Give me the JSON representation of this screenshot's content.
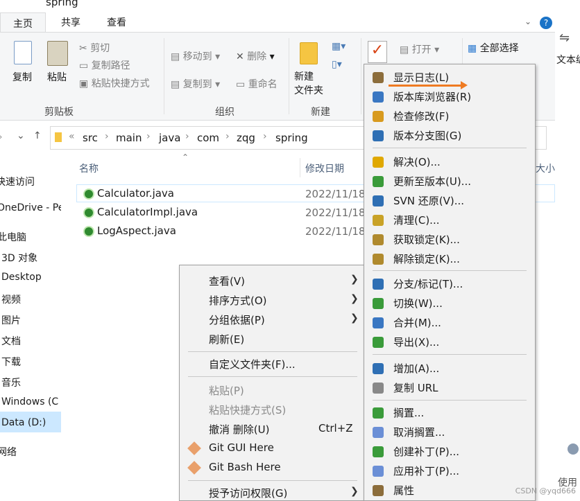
{
  "window": {
    "title": "spring"
  },
  "ribbon_tabs": [
    "主页",
    "共享",
    "查看"
  ],
  "clipboard": {
    "copy": "复制",
    "paste": "粘贴",
    "cut": "剪切",
    "copy_path": "复制路径",
    "paste_shortcut": "粘贴快捷方式",
    "label": "剪贴板"
  },
  "organize": {
    "move_to": "移动到",
    "copy_to": "复制到",
    "delete": "删除",
    "rename": "重命名",
    "label": "组织"
  },
  "new": {
    "new_folder": "新建\n文件夹",
    "label": "新建"
  },
  "open": {
    "open": "打开"
  },
  "select": {
    "select_all": "全部选择"
  },
  "right_cut_label": "文本编",
  "breadcrumb": [
    "src",
    "main",
    "java",
    "com",
    "zqg",
    "spring"
  ],
  "columns": {
    "name": "名称",
    "date": "修改日期",
    "size": "大小"
  },
  "files": [
    {
      "name": "Calculator.java",
      "date": "2022/11/18"
    },
    {
      "name": "CalculatorImpl.java",
      "date": "2022/11/18"
    },
    {
      "name": "LogAspect.java",
      "date": "2022/11/18"
    }
  ],
  "nav_items": [
    "快速访问",
    "OneDrive - Pe",
    "此电脑",
    "3D 对象",
    "Desktop",
    "视频",
    "图片",
    "文档",
    "下载",
    "音乐",
    "Windows (C",
    "Data (D:)",
    "网络"
  ],
  "context_menu": [
    {
      "label": "查看(V)",
      "sub": true
    },
    {
      "label": "排序方式(O)",
      "sub": true
    },
    {
      "label": "分组依据(P)",
      "sub": true
    },
    {
      "label": "刷新(E)"
    },
    {
      "label": "自定义文件夹(F)..."
    },
    {
      "label": "粘贴(P)",
      "disabled": true
    },
    {
      "label": "粘贴快捷方式(S)",
      "disabled": true
    },
    {
      "label": "撤消 删除(U)",
      "shortcut": "Ctrl+Z"
    },
    {
      "label": "Git GUI Here"
    },
    {
      "label": "Git Bash Here"
    },
    {
      "label": "授予访问权限(G)",
      "sub": true
    }
  ],
  "svn_menu": [
    "显示日志(L)",
    "版本库浏览器(R)",
    "检查修改(F)",
    "版本分支图(G)",
    "解决(O)...",
    "更新至版本(U)...",
    "SVN 还原(V)...",
    "清理(C)...",
    "获取锁定(K)...",
    "解除锁定(K)...",
    "分支/标记(T)...",
    "切换(W)...",
    "合并(M)...",
    "导出(X)...",
    "增加(A)...",
    "复制 URL",
    "搁置...",
    "取消搁置...",
    "创建补丁(P)...",
    "应用补丁(P)...",
    "属性"
  ],
  "right_bottom_label": "使用",
  "watermark": "CSDN @yqd666"
}
